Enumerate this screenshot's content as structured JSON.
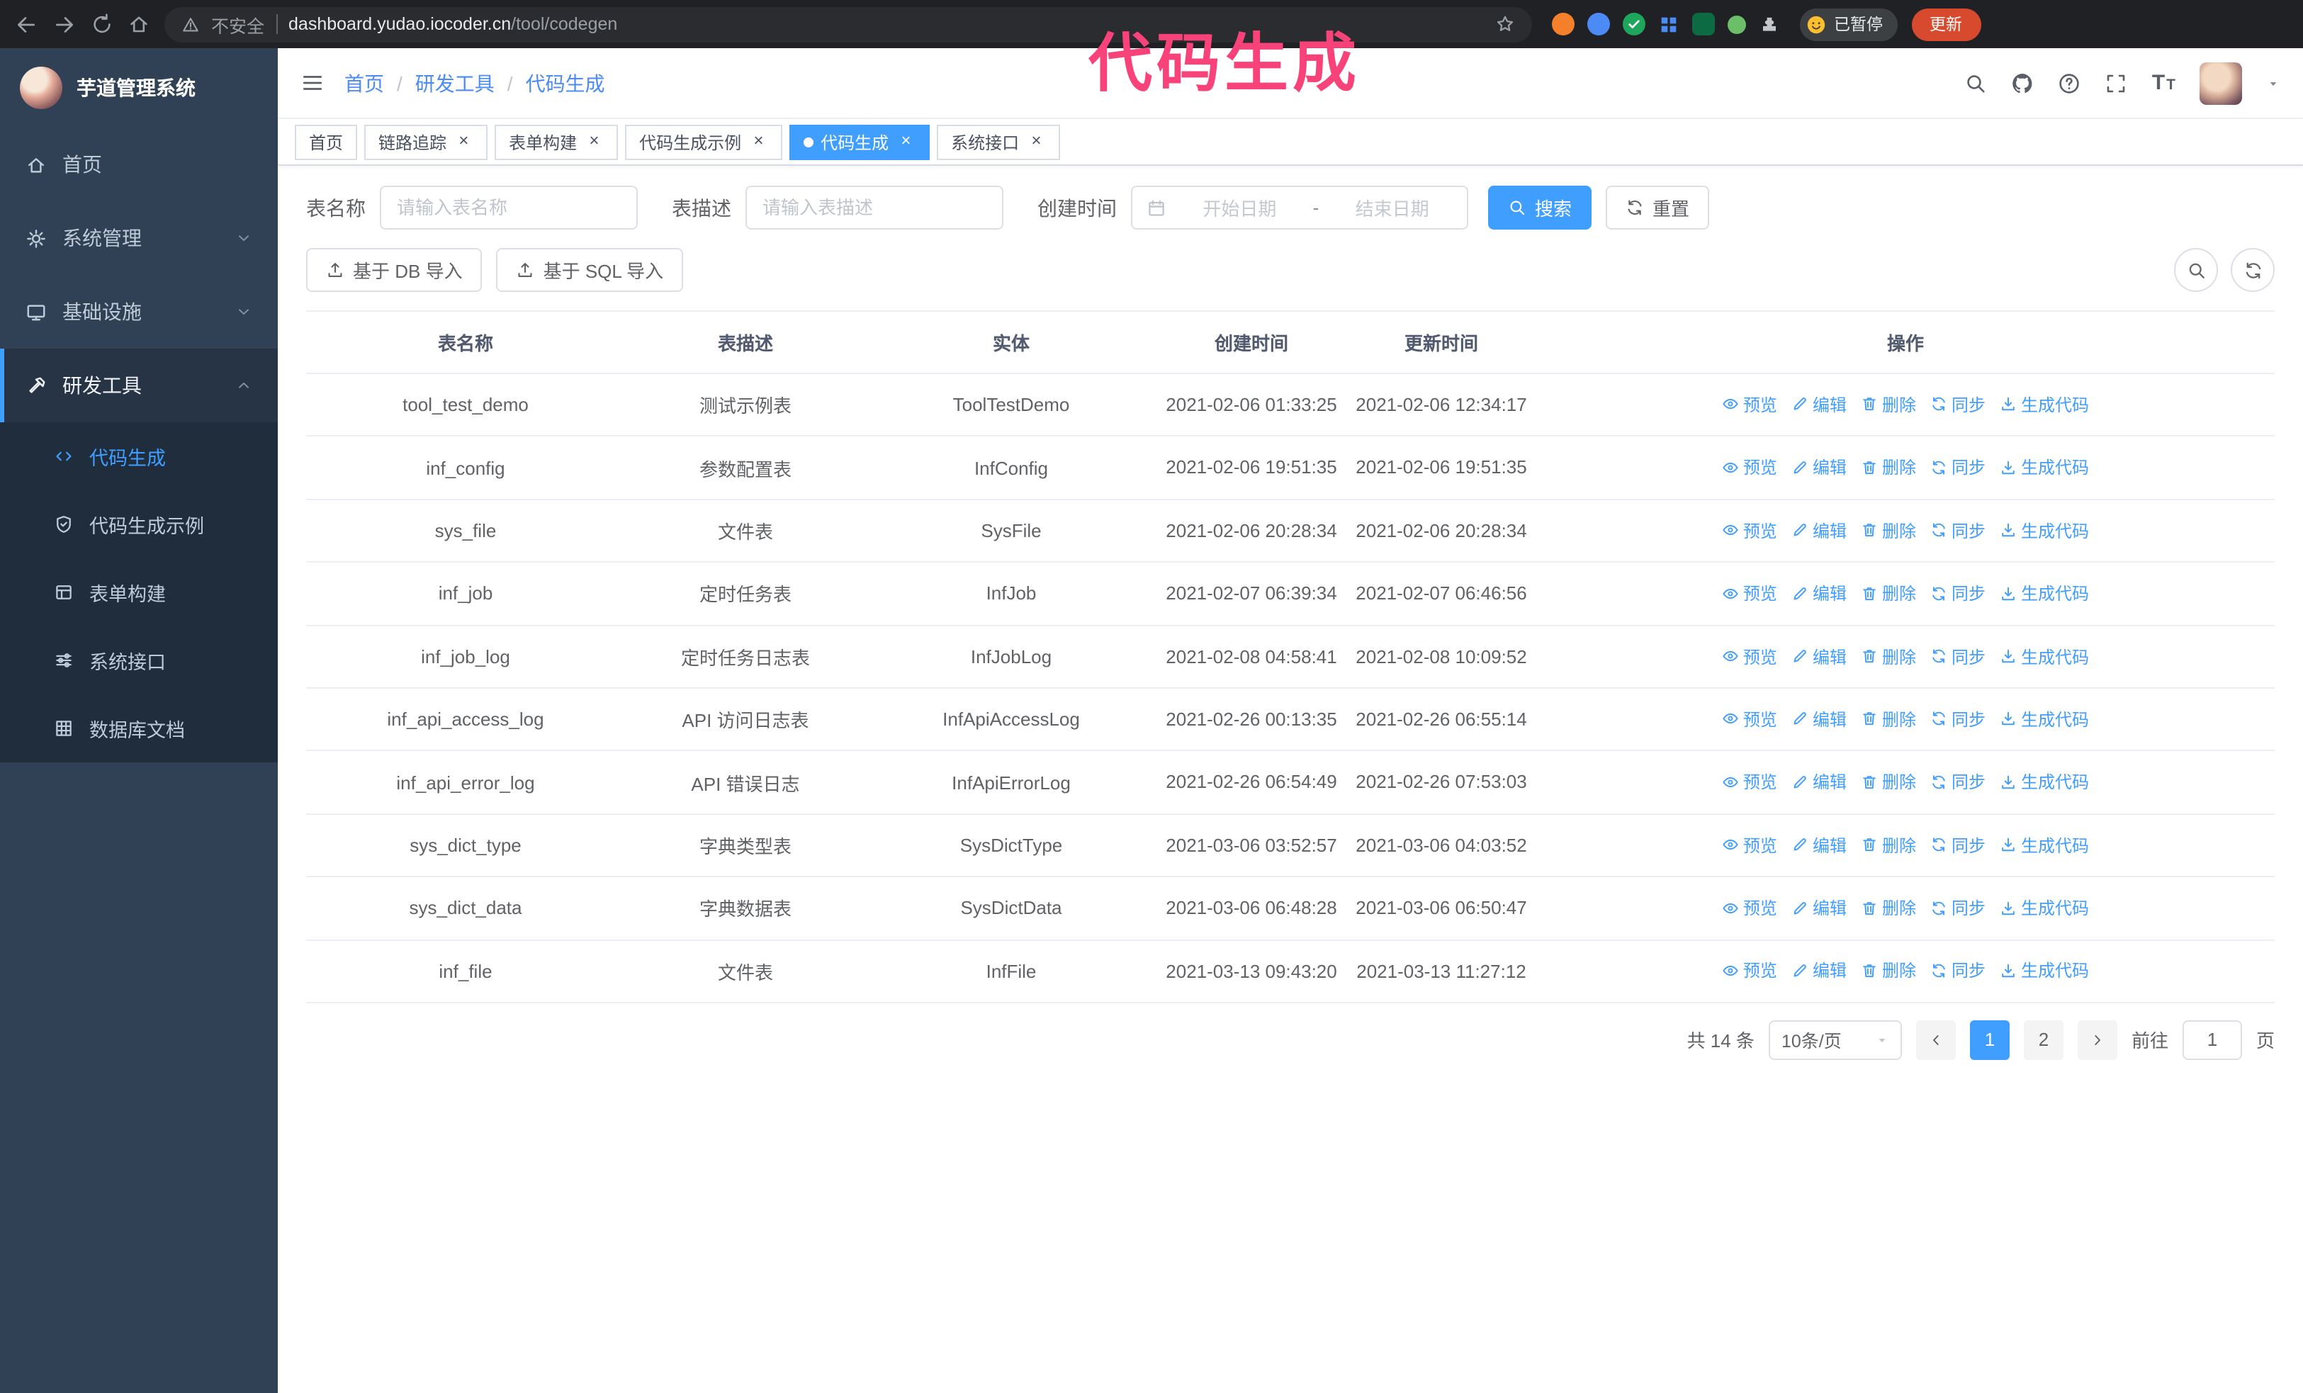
{
  "browser": {
    "security_label": "不安全",
    "url_domain": "dashboard.yudao.iocoder.cn",
    "url_path": "/tool/codegen",
    "paused_label": "已暂停",
    "update_label": "更新"
  },
  "annotation": {
    "text": "代码生成"
  },
  "sidebar": {
    "title": "芋道管理系统",
    "items": [
      {
        "label": "首页"
      },
      {
        "label": "系统管理"
      },
      {
        "label": "基础设施"
      },
      {
        "label": "研发工具"
      }
    ],
    "subitems": [
      {
        "label": "代码生成"
      },
      {
        "label": "代码生成示例"
      },
      {
        "label": "表单构建"
      },
      {
        "label": "系统接口"
      },
      {
        "label": "数据库文档"
      }
    ]
  },
  "header": {
    "breadcrumb": [
      "首页",
      "研发工具",
      "代码生成"
    ],
    "font_icon_big": "T",
    "font_icon_small": "T"
  },
  "tabs": [
    {
      "label": "首页"
    },
    {
      "label": "链路追踪"
    },
    {
      "label": "表单构建"
    },
    {
      "label": "代码生成示例"
    },
    {
      "label": "代码生成"
    },
    {
      "label": "系统接口"
    }
  ],
  "filters": {
    "name_label": "表名称",
    "name_placeholder": "请输入表名称",
    "desc_label": "表描述",
    "desc_placeholder": "请输入表描述",
    "time_label": "创建时间",
    "date_start_placeholder": "开始日期",
    "date_separator": "-",
    "date_end_placeholder": "结束日期",
    "search_label": "搜索",
    "reset_label": "重置"
  },
  "toolbar": {
    "import_db": "基于 DB 导入",
    "import_sql": "基于 SQL 导入"
  },
  "table": {
    "columns": [
      "表名称",
      "表描述",
      "实体",
      "创建时间",
      "更新时间",
      "操作"
    ],
    "actions": [
      "预览",
      "编辑",
      "删除",
      "同步",
      "生成代码"
    ],
    "rows": [
      {
        "name": "tool_test_demo",
        "desc": "测试示例表",
        "entity": "ToolTestDemo",
        "created": "2021-02-06 01:33:25",
        "updated": "2021-02-06 12:34:17"
      },
      {
        "name": "inf_config",
        "desc": "参数配置表",
        "entity": "InfConfig",
        "created": "2021-02-06 19:51:35",
        "updated": "2021-02-06 19:51:35"
      },
      {
        "name": "sys_file",
        "desc": "文件表",
        "entity": "SysFile",
        "created": "2021-02-06 20:28:34",
        "updated": "2021-02-06 20:28:34"
      },
      {
        "name": "inf_job",
        "desc": "定时任务表",
        "entity": "InfJob",
        "created": "2021-02-07 06:39:34",
        "updated": "2021-02-07 06:46:56"
      },
      {
        "name": "inf_job_log",
        "desc": "定时任务日志表",
        "entity": "InfJobLog",
        "created": "2021-02-08 04:58:41",
        "updated": "2021-02-08 10:09:52"
      },
      {
        "name": "inf_api_access_log",
        "desc": "API 访问日志表",
        "entity": "InfApiAccessLog",
        "created": "2021-02-26 00:13:35",
        "updated": "2021-02-26 06:55:14"
      },
      {
        "name": "inf_api_error_log",
        "desc": "API 错误日志",
        "entity": "InfApiErrorLog",
        "created": "2021-02-26 06:54:49",
        "updated": "2021-02-26 07:53:03"
      },
      {
        "name": "sys_dict_type",
        "desc": "字典类型表",
        "entity": "SysDictType",
        "created": "2021-03-06 03:52:57",
        "updated": "2021-03-06 04:03:52"
      },
      {
        "name": "sys_dict_data",
        "desc": "字典数据表",
        "entity": "SysDictData",
        "created": "2021-03-06 06:48:28",
        "updated": "2021-03-06 06:50:47"
      },
      {
        "name": "inf_file",
        "desc": "文件表",
        "entity": "InfFile",
        "created": "2021-03-13 09:43:20",
        "updated": "2021-03-13 11:27:12"
      }
    ]
  },
  "pagination": {
    "total": "共 14 条",
    "page_size": "10条/页",
    "pages": [
      "1",
      "2"
    ],
    "goto_label": "前往",
    "goto_value": "1",
    "page_unit": "页"
  },
  "icons": {
    "back-icon": "←",
    "forward-icon": "→",
    "reload-icon": "⟳",
    "home-icon": "⌂",
    "warning-icon": "⚠",
    "star-icon": "☆",
    "extension-icon": "●",
    "puzzle-icon": "puzzle",
    "search-icon": "magnifier",
    "github-icon": "octocat",
    "question-icon": "?",
    "fullscreen-icon": "⛶",
    "hamburger-icon": "☰",
    "gear-icon": "⚙",
    "monitor-icon": "screen",
    "tool-icon": "hammer",
    "code-icon": "</>",
    "shield-icon": "shield-check",
    "form-icon": "form",
    "sliders-icon": "sliders",
    "db-grid-icon": "grid",
    "calendar-icon": "calendar",
    "eye-icon": "eye",
    "edit-icon": "pencil",
    "delete-icon": "trash",
    "sync-icon": "⟳",
    "download-icon": "⤓",
    "upload-icon": "⤒",
    "close-icon": "×",
    "caret-down-icon": "▾",
    "chevron-left-icon": "‹",
    "chevron-right-icon": "›"
  }
}
